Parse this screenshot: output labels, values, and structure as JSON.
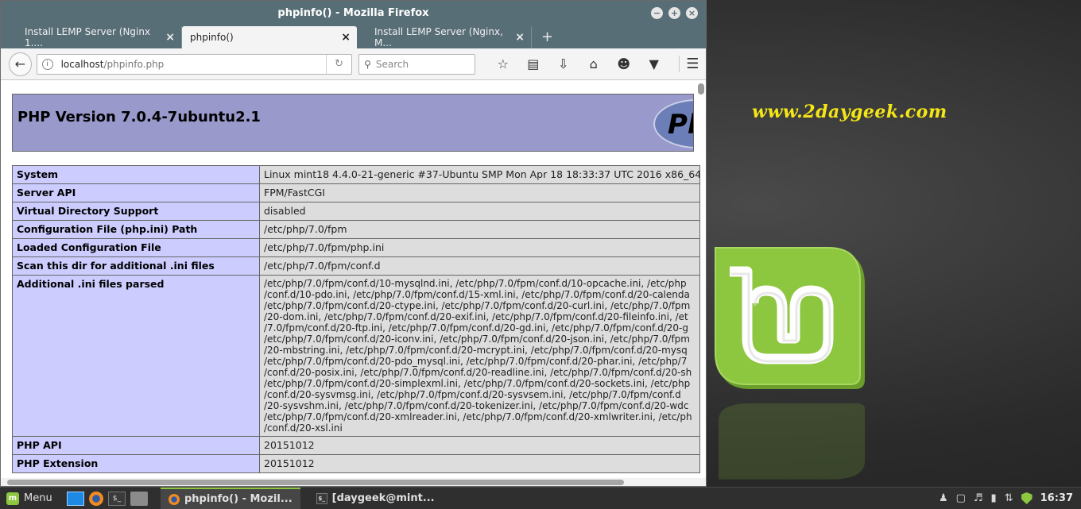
{
  "desktop": {
    "watermark": "www.2daygeek.com"
  },
  "window": {
    "title": "phpinfo() - Mozilla Firefox",
    "controls": [
      "−",
      "+",
      "×"
    ]
  },
  "tabs": [
    {
      "label": "Install LEMP Server (Nginx 1....",
      "active": false
    },
    {
      "label": "phpinfo()",
      "active": true
    },
    {
      "label": "Install LEMP Server (Nginx, M...",
      "active": false
    }
  ],
  "tab_close": "×",
  "new_tab": "+",
  "navbar": {
    "url_host": "localhost",
    "url_path": "/phpinfo.php",
    "search_placeholder": "Search"
  },
  "page": {
    "php_version": "PHP Version 7.0.4-7ubuntu2.1",
    "logo_text": "Ph",
    "rows": [
      {
        "name": "System",
        "value": "Linux mint18 4.4.0-21-generic #37-Ubuntu SMP Mon Apr 18 18:33:37 UTC 2016 x86_64"
      },
      {
        "name": "Server API",
        "value": "FPM/FastCGI"
      },
      {
        "name": "Virtual Directory Support",
        "value": "disabled"
      },
      {
        "name": "Configuration File (php.ini) Path",
        "value": "/etc/php/7.0/fpm"
      },
      {
        "name": "Loaded Configuration File",
        "value": "/etc/php/7.0/fpm/php.ini"
      },
      {
        "name": "Scan this dir for additional .ini files",
        "value": "/etc/php/7.0/fpm/conf.d"
      }
    ],
    "additional_label": "Additional .ini files parsed",
    "additional_lines": [
      "/etc/php/7.0/fpm/conf.d/10-mysqlnd.ini, /etc/php/7.0/fpm/conf.d/10-opcache.ini, /etc/php",
      "/conf.d/10-pdo.ini, /etc/php/7.0/fpm/conf.d/15-xml.ini, /etc/php/7.0/fpm/conf.d/20-calenda",
      "/etc/php/7.0/fpm/conf.d/20-ctype.ini, /etc/php/7.0/fpm/conf.d/20-curl.ini, /etc/php/7.0/fpm",
      "/20-dom.ini, /etc/php/7.0/fpm/conf.d/20-exif.ini, /etc/php/7.0/fpm/conf.d/20-fileinfo.ini, /et",
      "/7.0/fpm/conf.d/20-ftp.ini, /etc/php/7.0/fpm/conf.d/20-gd.ini, /etc/php/7.0/fpm/conf.d/20-g",
      "/etc/php/7.0/fpm/conf.d/20-iconv.ini, /etc/php/7.0/fpm/conf.d/20-json.ini, /etc/php/7.0/fpm",
      "/20-mbstring.ini, /etc/php/7.0/fpm/conf.d/20-mcrypt.ini, /etc/php/7.0/fpm/conf.d/20-mysq",
      "/etc/php/7.0/fpm/conf.d/20-pdo_mysql.ini, /etc/php/7.0/fpm/conf.d/20-phar.ini, /etc/php/7",
      "/conf.d/20-posix.ini, /etc/php/7.0/fpm/conf.d/20-readline.ini, /etc/php/7.0/fpm/conf.d/20-sh",
      "/etc/php/7.0/fpm/conf.d/20-simplexml.ini, /etc/php/7.0/fpm/conf.d/20-sockets.ini, /etc/php",
      "/conf.d/20-sysvmsg.ini, /etc/php/7.0/fpm/conf.d/20-sysvsem.ini, /etc/php/7.0/fpm/conf.d",
      "/20-sysvshm.ini, /etc/php/7.0/fpm/conf.d/20-tokenizer.ini, /etc/php/7.0/fpm/conf.d/20-wdc",
      "/etc/php/7.0/fpm/conf.d/20-xmlreader.ini, /etc/php/7.0/fpm/conf.d/20-xmlwriter.ini, /etc/ph",
      "/conf.d/20-xsl.ini"
    ],
    "rows_after": [
      {
        "name": "PHP API",
        "value": "20151012"
      },
      {
        "name": "PHP Extension",
        "value": "20151012"
      }
    ]
  },
  "taskbar": {
    "menu_label": "Menu",
    "tasks": [
      {
        "label": "phpinfo() - Mozil...",
        "active": true
      },
      {
        "label": "[daygeek@mint...",
        "active": false
      }
    ],
    "clock": "16:37"
  },
  "colors": {
    "titlebar": "#586e76",
    "php_header": "#9999cc",
    "row_label": "#ccccff",
    "row_value": "#dddddd",
    "watermark": "#f5e617",
    "mint_green": "#8dc63f"
  }
}
